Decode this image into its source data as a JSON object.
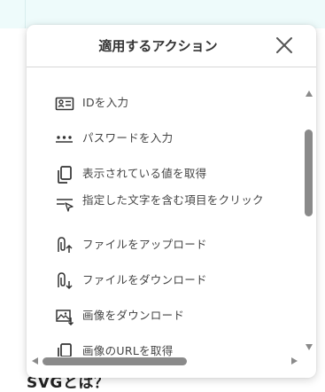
{
  "background": {
    "heading": "SVGとは？",
    "top_color": "#eefbfb"
  },
  "panel": {
    "title": "適用するアクション",
    "close_icon": "close-icon"
  },
  "actions": [
    {
      "label": "IDを入力",
      "icon": "id-card-icon"
    },
    {
      "label": "パスワードを入力",
      "icon": "password-dots-icon"
    },
    {
      "label": "表示されている値を取得",
      "icon": "copy-icon"
    },
    {
      "label": "指定した文字を含む項目をクリック",
      "icon": "text-click-icon"
    },
    {
      "label": "ファイルをアップロード",
      "icon": "attachment-upload-icon"
    },
    {
      "label": "ファイルをダウンロード",
      "icon": "attachment-download-icon"
    },
    {
      "label": "画像をダウンロード",
      "icon": "image-download-icon"
    },
    {
      "label": "画像のURLを取得",
      "icon": "image-url-icon"
    }
  ],
  "colors": {
    "text": "#444444",
    "scrollbar": "#8a8a8a",
    "divider": "#d7d7d7"
  }
}
